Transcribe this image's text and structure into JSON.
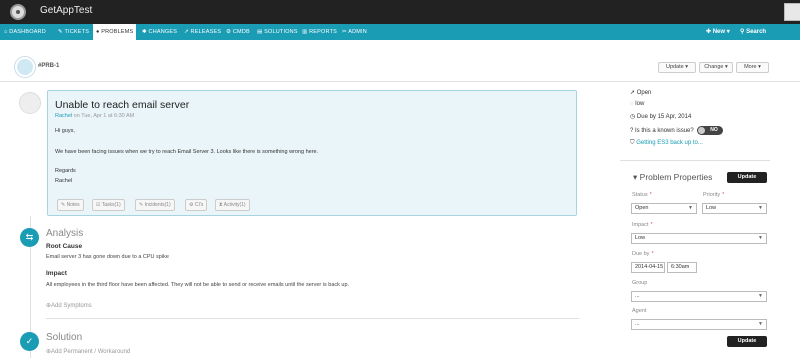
{
  "app": {
    "name": "GetAppTest"
  },
  "nav": {
    "items": [
      {
        "icon": "dashboard-icon",
        "label": "DASHBOARD"
      },
      {
        "icon": "tickets-icon",
        "label": "TICKETS"
      },
      {
        "icon": "problems-icon",
        "label": "PROBLEMS",
        "active": true
      },
      {
        "icon": "changes-icon",
        "label": "CHANGES"
      },
      {
        "icon": "releases-icon",
        "label": "RELEASES"
      },
      {
        "icon": "cmdb-icon",
        "label": "CMDB"
      },
      {
        "icon": "solutions-icon",
        "label": "SOLUTIONS"
      },
      {
        "icon": "reports-icon",
        "label": "REPORTS"
      },
      {
        "icon": "admin-icon",
        "label": "ADMIN"
      }
    ],
    "new_label": "New",
    "search_label": "Search"
  },
  "header": {
    "problem_id": "#PRB-1",
    "buttons": {
      "update": "Update",
      "change": "Change",
      "more": "More"
    }
  },
  "problem": {
    "title": "Unable to reach email server",
    "author": "Rachel",
    "date": " on Tue, Apr 1 at 6:30 AM",
    "greeting": "Hi guys,",
    "body": "We have been facing issues when we try to reach Email Server 3. Looks like there is something wrong here.",
    "signoff1": "Regards",
    "signoff2": "Rachel",
    "tabs": [
      "Notes",
      "Tasks(1)",
      "Incidents(1)",
      "CI's",
      "Activity(1)"
    ]
  },
  "analysis": {
    "title": "Analysis",
    "root_cause_label": "Root Cause",
    "root_cause": "Email server 3 has gone down due to a CPU spike",
    "impact_label": "Impact",
    "impact": "All employees in the third floor have been affected. They will not be able to send or receive emails until the server is back up.",
    "add_symptoms": "Add Symptoms"
  },
  "solution": {
    "title": "Solution",
    "add_permanent": "Add Permanent / Workaround"
  },
  "sidebar": {
    "status": "Open",
    "priority": "low",
    "due": "Due by 15 Apr, 2014",
    "known_issue_label": "Is this a known issue?",
    "known_issue_value": "NO",
    "related_link": "Getting ES3 back up to..."
  },
  "properties": {
    "title": "Problem Properties",
    "update_label": "Update",
    "status_label": "Status",
    "status_value": "Open",
    "priority_label": "Priority",
    "priority_value": "Low",
    "impact_label": "Impact",
    "impact_value": "Low",
    "due_label": "Due by",
    "due_date": "2014-04-15",
    "due_time": "6:30am",
    "group_label": "Group",
    "group_value": "...",
    "agent_label": "Agent",
    "agent_value": "...",
    "update_bottom": "Update"
  },
  "colors": {
    "accent": "#1a9cb5",
    "topbar": "#222222",
    "card_bg": "#eaf5f9"
  }
}
